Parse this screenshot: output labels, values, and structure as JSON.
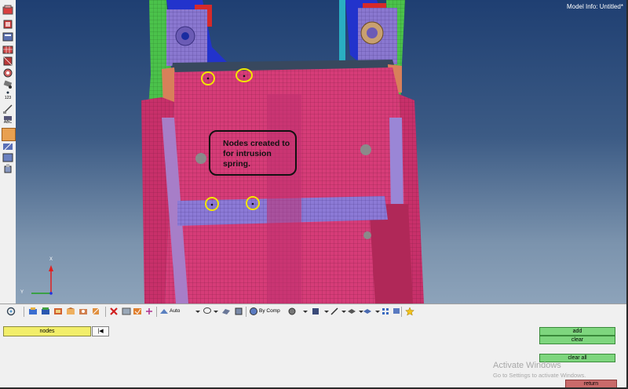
{
  "viewport": {
    "model_info": "Model Info: Untitled*",
    "callout_text": "Nodes created to for intrusion spring.",
    "axis_labels": {
      "x": "X",
      "y": "Y"
    },
    "background_color": "#2e4c7c"
  },
  "left_toolbar": {
    "icons": [
      "component-icon",
      "assembly-icon",
      "model-browser-icon",
      "mesh-icon",
      "element-icon",
      "connector-icon",
      "label-icon",
      "numbering-icon",
      "measure-icon",
      "abc-annotation-icon",
      "abc-label-icon",
      "vector-icon",
      "system-icon",
      "material-icon"
    ],
    "numbering_label": "123",
    "abc_label": "ABC"
  },
  "bottom_toolbar": {
    "auto_label": "Auto",
    "by_comp_label": "By Comp"
  },
  "panel": {
    "selector_label": "nodes",
    "reset_label": "|◀",
    "add_label": "add",
    "clear_label": "clear",
    "clear_all_label": "clear all",
    "return_label": "return",
    "accent_green": "#7ed67e",
    "accent_red": "#c96a6a"
  },
  "watermark": {
    "title": "Activate Windows",
    "subtitle": "Go to Settings to activate Windows."
  }
}
